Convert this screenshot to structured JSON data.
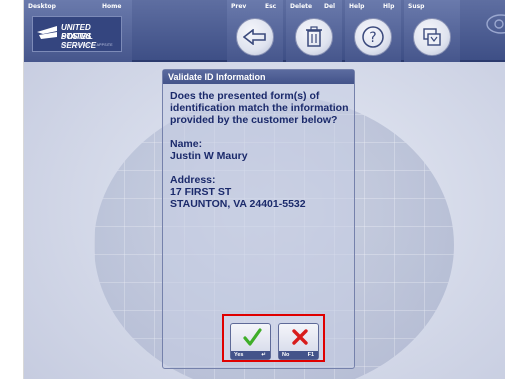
{
  "toolbar": {
    "desktop_label": "Desktop",
    "home_label": "Home",
    "prev_label": "Prev",
    "prev_key": "Esc",
    "delete_label": "Delete",
    "delete_key": "Del",
    "help_label": "Help",
    "help_key": "Hlp",
    "susp_label": "Susp"
  },
  "logo": {
    "line1": "UNITED STATES",
    "line2": "POSTAL SERVICE",
    "line3": "RSS POWERED BY APPSITE"
  },
  "dialog": {
    "title": "Validate ID Information",
    "question": "Does the presented form(s) of identification match the information provided by the customer below?",
    "name_label": "Name:",
    "name_value": "Justin W Maury",
    "address_label": "Address:",
    "address_line1": "17 FIRST ST",
    "address_line2": "STAUNTON, VA 24401-5532"
  },
  "actions": {
    "yes_label": "Yes",
    "yes_key": "↵",
    "no_label": "No",
    "no_key": "F1"
  },
  "colors": {
    "toolbar": "#46568c",
    "dialog_text": "#1b2a6b",
    "highlight": "#e00000",
    "yes_icon": "#3fae29",
    "no_icon": "#d81c1c"
  }
}
